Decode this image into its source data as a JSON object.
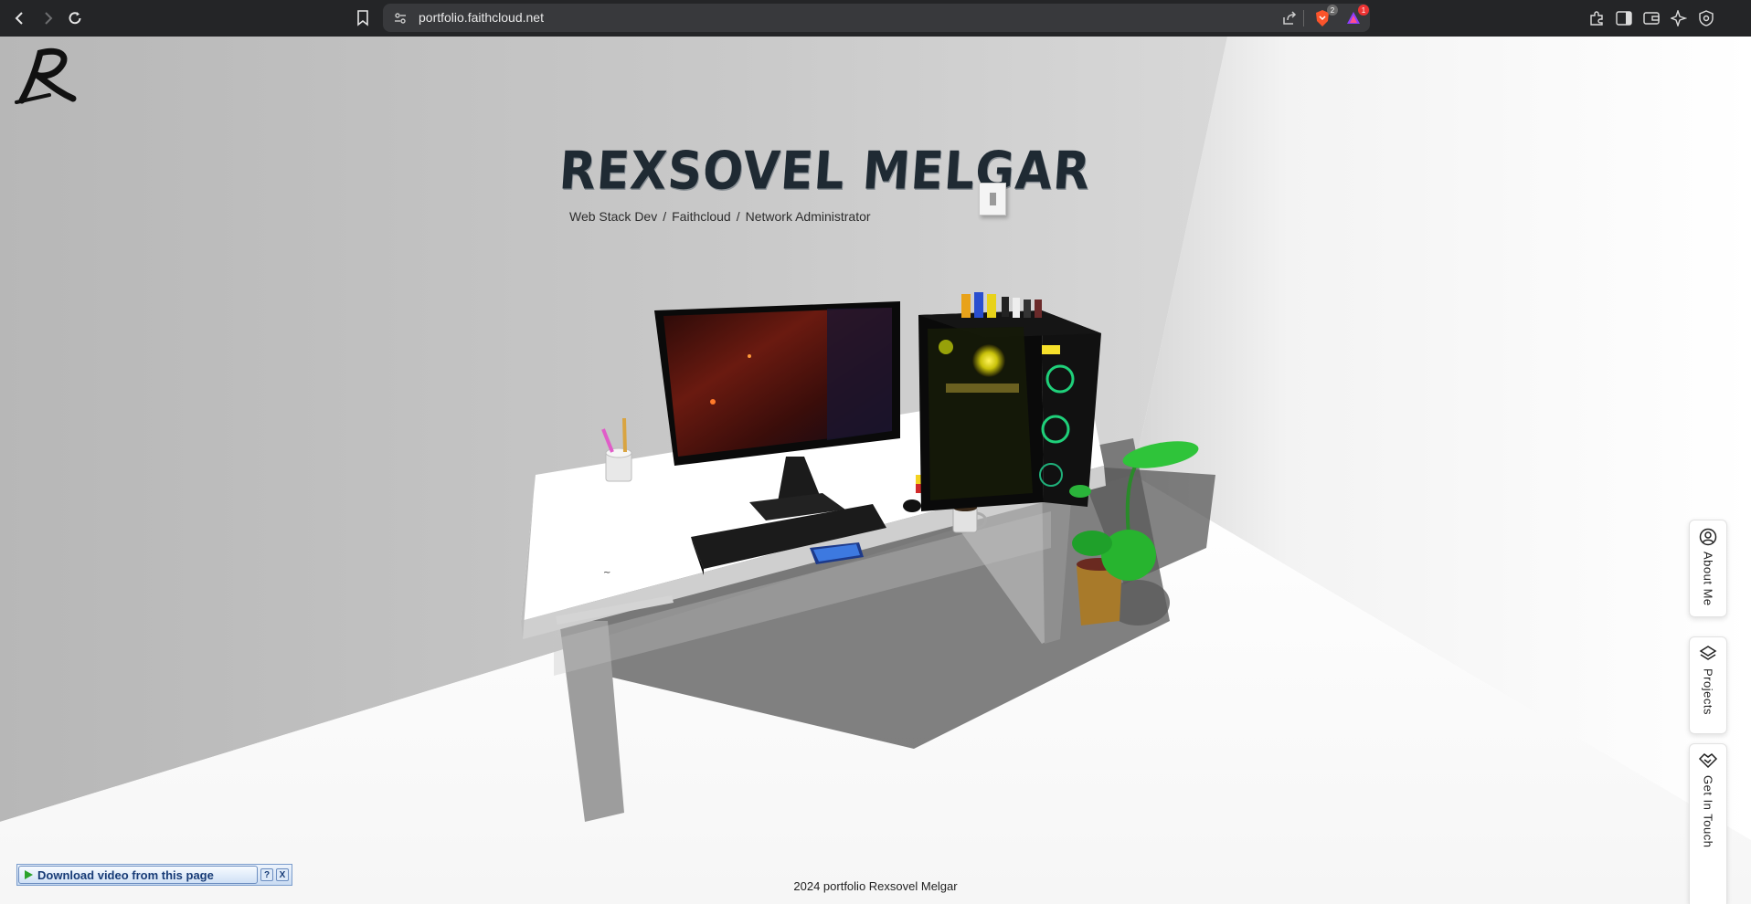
{
  "browser": {
    "url": "portfolio.faithcloud.net",
    "shield_badge": "2",
    "alert_badge": "1"
  },
  "hero": {
    "logo_letter": "R",
    "title": "REXSOVEL MELGAR",
    "roles": [
      "Web Stack Dev",
      "/",
      "Faithcloud",
      "/",
      "Network Administrator"
    ]
  },
  "side_nav": {
    "about": "About Me",
    "projects": "Projects",
    "contact": "Get In Touch"
  },
  "footer": {
    "text": "2024 portfolio Rexsovel Melgar"
  },
  "downloader": {
    "label": "Download video from this page",
    "help": "?",
    "close": "X"
  },
  "colors": {
    "browser_bar": "#242527",
    "title": "#1f2a33"
  }
}
